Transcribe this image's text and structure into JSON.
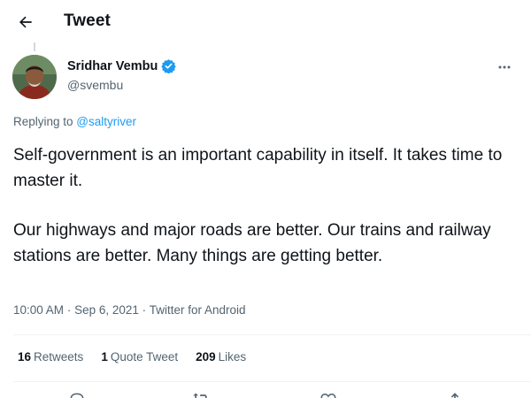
{
  "header": {
    "title": "Tweet",
    "back_icon": "arrow-left-icon"
  },
  "author": {
    "name": "Sridhar Vembu",
    "handle": "@svembu",
    "verified": true,
    "verified_color": "#1d9bf0"
  },
  "reply": {
    "prefix": "Replying to ",
    "to": "@saltyriver"
  },
  "tweet": {
    "paragraphs": [
      "Self-government is an important capability in itself. It takes time to master it.",
      "Our highways and major roads are better. Our trains and railway stations are better. Many things are getting better."
    ]
  },
  "meta": {
    "time": "10:00 AM",
    "sep": "·",
    "date": "Sep 6, 2021",
    "source": "Twitter for Android"
  },
  "stats": [
    {
      "count": "16",
      "label": "Retweets"
    },
    {
      "count": "1",
      "label": "Quote Tweet"
    },
    {
      "count": "209",
      "label": "Likes"
    }
  ],
  "actions": [
    "reply-icon",
    "retweet-icon",
    "like-icon",
    "share-icon"
  ],
  "colors": {
    "accent": "#1d9bf0",
    "text": "#0f1419",
    "secondary": "#536471",
    "border": "#eff3f4"
  }
}
